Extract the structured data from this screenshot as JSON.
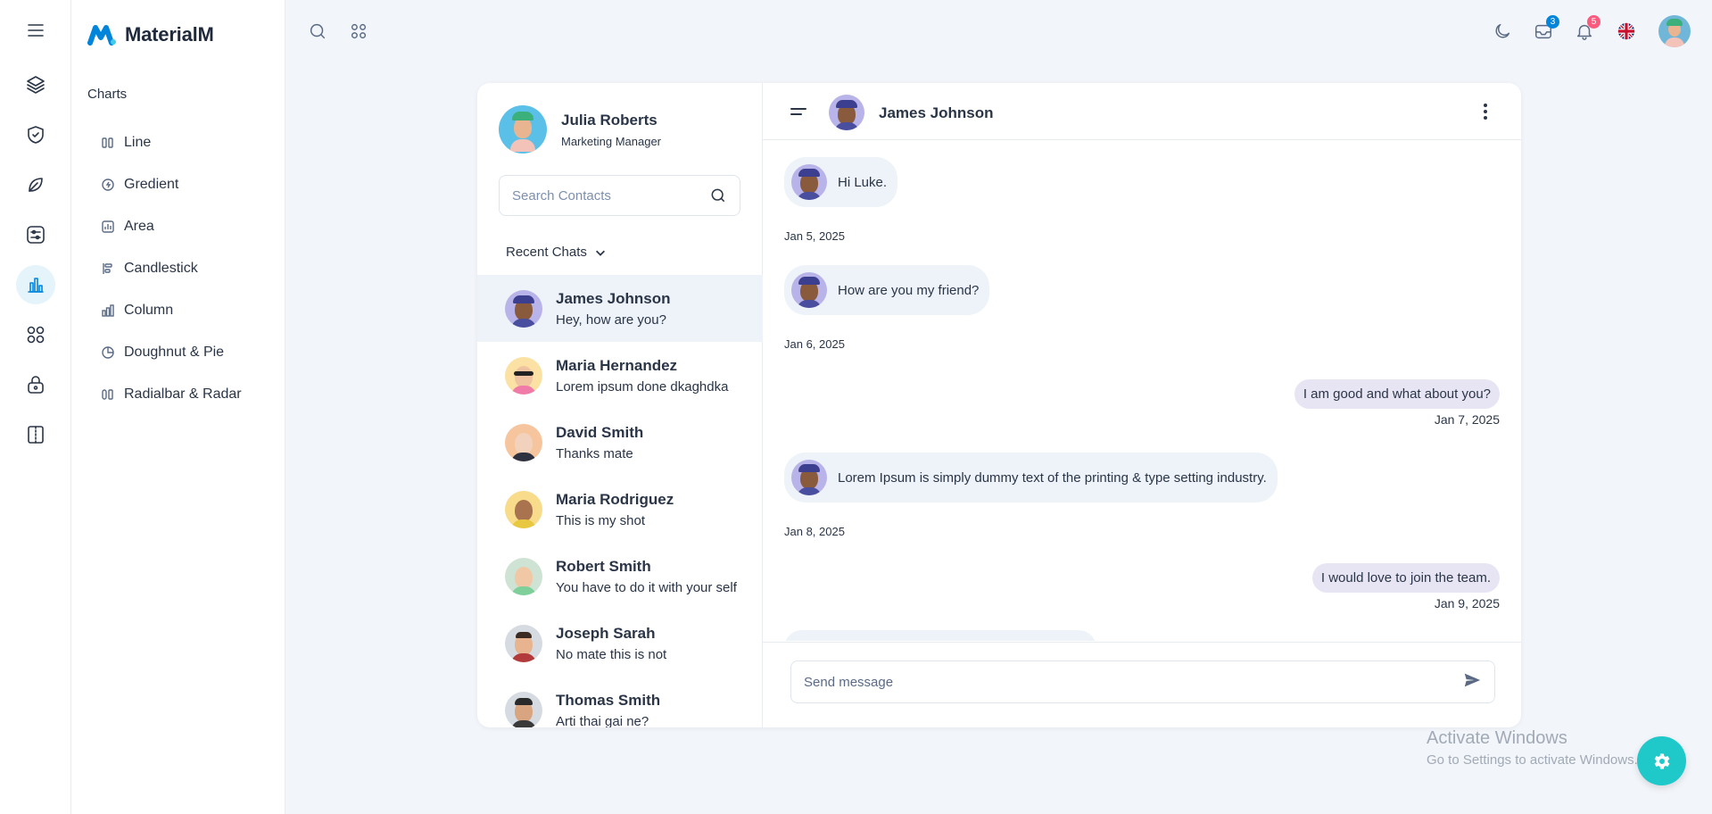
{
  "brand": {
    "name": "MaterialM"
  },
  "rail": {
    "icons": [
      "layers-icon",
      "shield-icon",
      "leaf-icon",
      "sliders-icon",
      "chart-icon",
      "apps-icon",
      "lock-icon",
      "book-icon"
    ],
    "active": "chart-icon"
  },
  "sidebar": {
    "section_title": "Charts",
    "items": [
      {
        "label": "Line",
        "icon": "line-chart-icon"
      },
      {
        "label": "Gredient",
        "icon": "gradient-icon"
      },
      {
        "label": "Area",
        "icon": "area-chart-icon"
      },
      {
        "label": "Candlestick",
        "icon": "candlestick-icon"
      },
      {
        "label": "Column",
        "icon": "column-chart-icon"
      },
      {
        "label": "Doughnut & Pie",
        "icon": "pie-chart-icon"
      },
      {
        "label": "Radialbar & Radar",
        "icon": "radialbar-icon"
      }
    ]
  },
  "topbar": {
    "mail_badge": "3",
    "notification_badge": "5"
  },
  "profile": {
    "name": "Julia Roberts",
    "role": "Marketing Manager"
  },
  "contacts": {
    "search_placeholder": "Search Contacts",
    "recent_label": "Recent Chats",
    "items": [
      {
        "name": "James Johnson",
        "message": "Hey, how are you?"
      },
      {
        "name": "Maria Hernandez",
        "message": "Lorem ipsum done dkaghdka"
      },
      {
        "name": "David Smith",
        "message": "Thanks mate"
      },
      {
        "name": "Maria Rodriguez",
        "message": "This is my shot"
      },
      {
        "name": "Robert Smith",
        "message": "You have to do it with your self"
      },
      {
        "name": "Joseph Sarah",
        "message": "No mate this is not"
      },
      {
        "name": "Thomas Smith",
        "message": "Arti thai gai ne?"
      }
    ]
  },
  "chat": {
    "contact_name": "James Johnson",
    "messages": [
      {
        "direction": "in",
        "text": "Hi Luke.",
        "date": "Jan 5, 2025"
      },
      {
        "direction": "in",
        "text": "How are you my friend?",
        "date": "Jan 6, 2025"
      },
      {
        "direction": "out",
        "text": "I am good and what about you?",
        "date": "Jan 7, 2025"
      },
      {
        "direction": "in",
        "text": "Lorem Ipsum is simply dummy text of the printing & type setting industry.",
        "date": "Jan 8, 2025"
      },
      {
        "direction": "out",
        "text": "I would love to join the team.",
        "date": "Jan 9, 2025"
      }
    ],
    "composer_placeholder": "Send message"
  },
  "watermark": {
    "line1": "Activate Windows",
    "line2": "Go to Settings to activate Windows."
  }
}
